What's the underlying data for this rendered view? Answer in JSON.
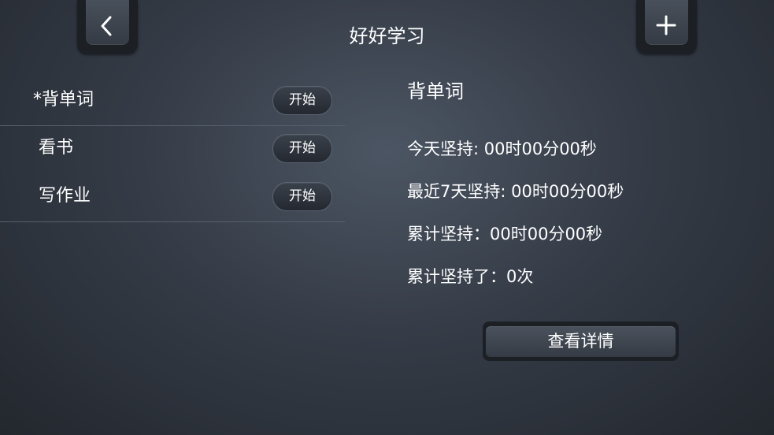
{
  "header": {
    "title": "好好学习",
    "back_icon": "chevron-left-icon",
    "add_icon": "plus-icon"
  },
  "tasks": [
    {
      "name": "*背单词",
      "button_label": "开始"
    },
    {
      "name": "看书",
      "button_label": "开始"
    },
    {
      "name": "写作业",
      "button_label": "开始"
    }
  ],
  "detail": {
    "title": "背单词",
    "today": "今天坚持: 00时00分00秒",
    "last7": "最近7天坚持: 00时00分00秒",
    "total": "累计坚持：00时00分00秒",
    "count": "累计坚持了：0次",
    "view_button": "查看详情"
  },
  "colors": {
    "background": "#353c47",
    "text": "#ffffff",
    "divider": "#56606c"
  }
}
